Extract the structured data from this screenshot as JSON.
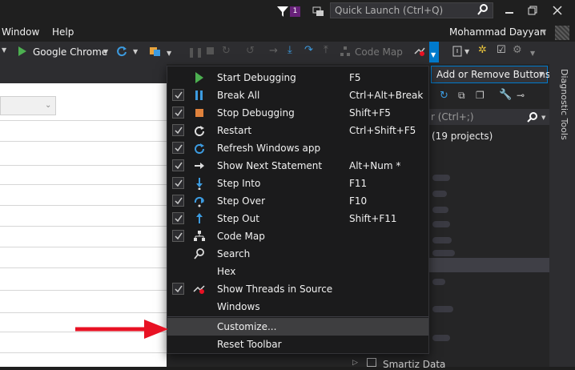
{
  "quick_launch": {
    "placeholder": "Quick Launch (Ctrl+Q)",
    "notification_count": "1"
  },
  "menu": {
    "items": [
      "Window",
      "Help"
    ]
  },
  "user": {
    "name": "Mohammad Dayyan"
  },
  "toolbar": {
    "browser_label": "Google Chrome",
    "code_map_label": "Code Map",
    "add_remove_label": "Add or Remove Buttons"
  },
  "side_panel": {
    "title": "Diagnostic Tools",
    "search_placeholder": "r (Ctrl+;)",
    "projects_text": "(19 projects)",
    "bottom_item": "Smartiz Data"
  },
  "dropdown": {
    "items": [
      {
        "label": "Start Debugging",
        "shortcut": "F5",
        "checked": false,
        "icon": "play-icon"
      },
      {
        "label": "Break All",
        "shortcut": "Ctrl+Alt+Break",
        "checked": true,
        "icon": "pause-icon"
      },
      {
        "label": "Stop Debugging",
        "shortcut": "Shift+F5",
        "checked": true,
        "icon": "stop-icon"
      },
      {
        "label": "Restart",
        "shortcut": "Ctrl+Shift+F5",
        "checked": true,
        "icon": "restart-icon"
      },
      {
        "label": "Refresh Windows app",
        "shortcut": "",
        "checked": true,
        "icon": "refresh-icon"
      },
      {
        "label": "Show Next Statement",
        "shortcut": "Alt+Num *",
        "checked": true,
        "icon": "arrow-right-icon"
      },
      {
        "label": "Step Into",
        "shortcut": "F11",
        "checked": true,
        "icon": "step-into-icon"
      },
      {
        "label": "Step Over",
        "shortcut": "F10",
        "checked": true,
        "icon": "step-over-icon"
      },
      {
        "label": "Step Out",
        "shortcut": "Shift+F11",
        "checked": true,
        "icon": "step-out-icon"
      },
      {
        "label": "Code Map",
        "shortcut": "",
        "checked": true,
        "icon": "code-map-icon"
      },
      {
        "label": "Search",
        "shortcut": "",
        "checked": false,
        "icon": "search-icon"
      },
      {
        "label": "Hex",
        "shortcut": "",
        "checked": false,
        "icon": ""
      },
      {
        "label": "Show Threads in Source",
        "shortcut": "",
        "checked": true,
        "icon": "threads-icon"
      },
      {
        "label": "Windows",
        "shortcut": "",
        "checked": false,
        "icon": ""
      }
    ],
    "customize": "Customize...",
    "reset": "Reset Toolbar"
  },
  "colors": {
    "accent": "#007acc",
    "arrow": "#e81123",
    "badge": "#68217a"
  }
}
